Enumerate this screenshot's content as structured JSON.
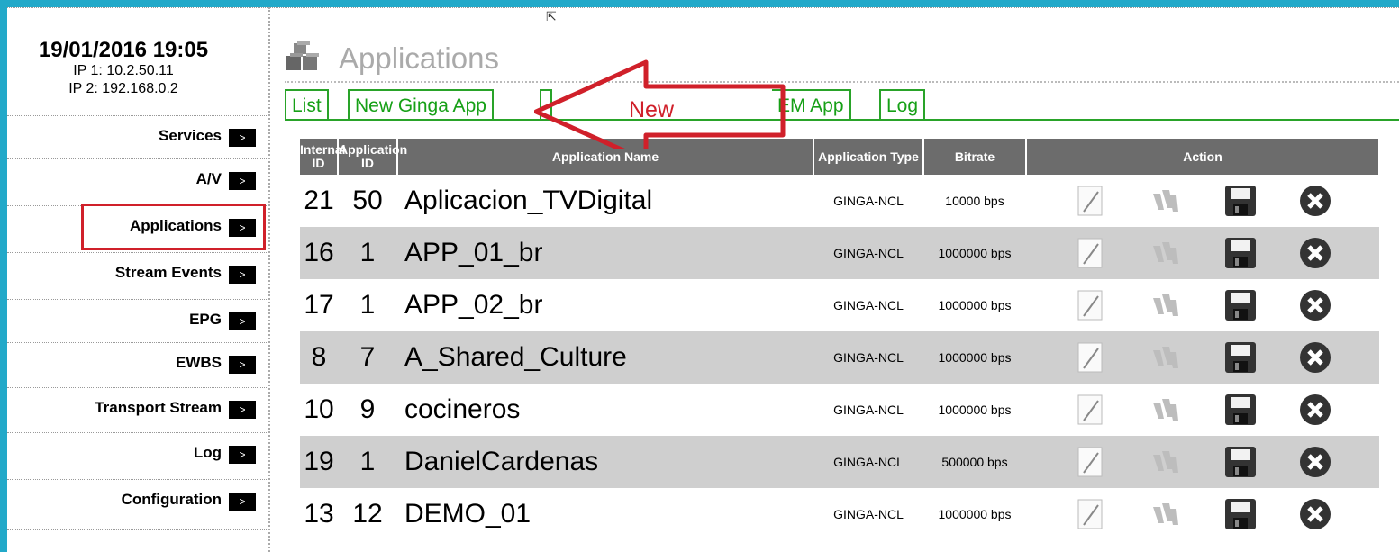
{
  "sidebar": {
    "datetime": "19/01/2016 19:05",
    "ip1": "IP 1: 10.2.50.11",
    "ip2": "IP 2: 192.168.0.2",
    "arrow": ">",
    "items": [
      {
        "label": "Services"
      },
      {
        "label": "A/V"
      },
      {
        "label": "Applications"
      },
      {
        "label": "Stream Events"
      },
      {
        "label": "EPG"
      },
      {
        "label": "EWBS"
      },
      {
        "label": "Transport Stream"
      },
      {
        "label": "Log"
      },
      {
        "label": "Configuration"
      }
    ]
  },
  "main": {
    "title": "Applications",
    "tabs": [
      {
        "label": "List"
      },
      {
        "label": "New Ginga App"
      },
      {
        "label": "EM App"
      },
      {
        "label": "Log"
      }
    ]
  },
  "annotation": {
    "text": "New",
    "color": "#d0202a"
  },
  "table": {
    "headers": {
      "internal_id": "Internal ID",
      "application_id": "Application ID",
      "name": "Application Name",
      "type": "Application Type",
      "bitrate": "Bitrate",
      "action": "Action"
    },
    "rows": [
      {
        "internal_id": "21",
        "app_id": "50",
        "name": "Aplicacion_TVDigital",
        "type": "GINGA-NCL",
        "bitrate": "10000 bps"
      },
      {
        "internal_id": "16",
        "app_id": "1",
        "name": "APP_01_br",
        "type": "GINGA-NCL",
        "bitrate": "1000000 bps"
      },
      {
        "internal_id": "17",
        "app_id": "1",
        "name": "APP_02_br",
        "type": "GINGA-NCL",
        "bitrate": "1000000 bps"
      },
      {
        "internal_id": "8",
        "app_id": "7",
        "name": "A_Shared_Culture",
        "type": "GINGA-NCL",
        "bitrate": "1000000 bps"
      },
      {
        "internal_id": "10",
        "app_id": "9",
        "name": "cocineros",
        "type": "GINGA-NCL",
        "bitrate": "1000000 bps"
      },
      {
        "internal_id": "19",
        "app_id": "1",
        "name": "DanielCardenas",
        "type": "GINGA-NCL",
        "bitrate": "500000 bps"
      },
      {
        "internal_id": "13",
        "app_id": "12",
        "name": "DEMO_01",
        "type": "GINGA-NCL",
        "bitrate": "1000000 bps"
      }
    ]
  },
  "colors": {
    "accent_green": "#29a329",
    "header_gray": "#6c6c6c",
    "row_alt": "#cfcfcf",
    "annotation_red": "#d0202a"
  }
}
